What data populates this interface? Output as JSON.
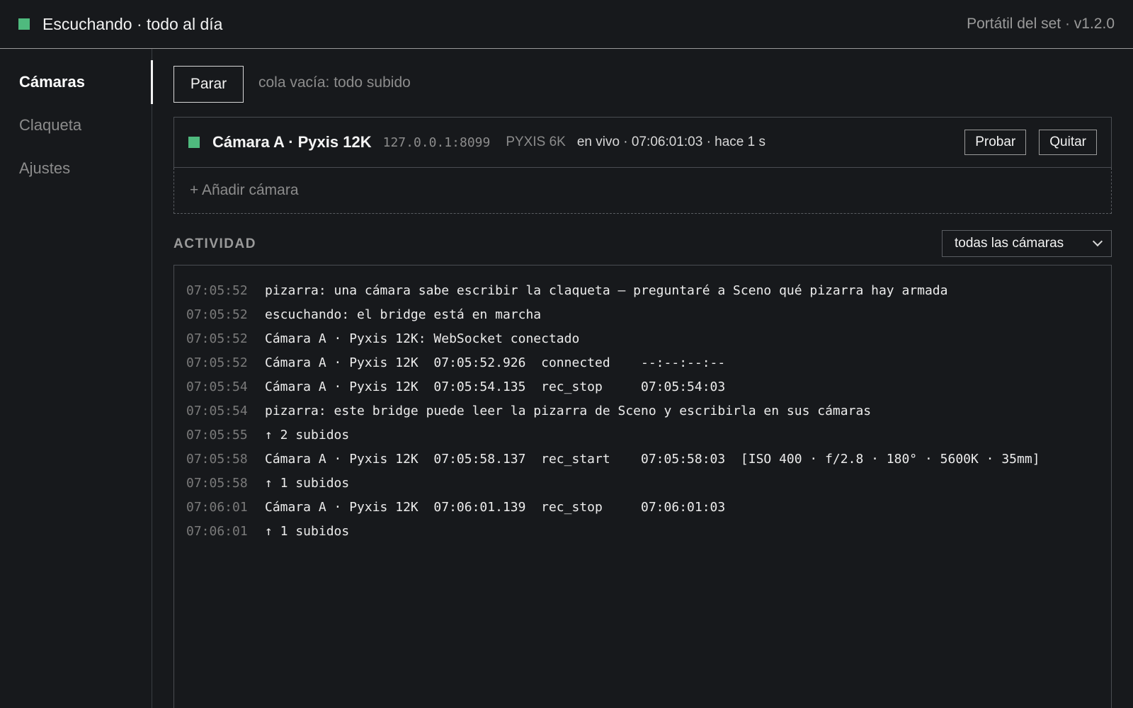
{
  "header": {
    "title": "Escuchando · todo al día",
    "version": "Portátil del set · v1.2.0",
    "status_color": "#4fba7e"
  },
  "sidebar": {
    "items": [
      {
        "label": "Cámaras",
        "active": true
      },
      {
        "label": "Claqueta",
        "active": false
      },
      {
        "label": "Ajustes",
        "active": false
      }
    ]
  },
  "main": {
    "stop_label": "Parar",
    "queue_status": "cola vacía: todo subido",
    "camera": {
      "name": "Cámara A · Pyxis 12K",
      "address": "127.0.0.1:8099",
      "model": "PYXIS 6K",
      "live_status": "en vivo · 07:06:01:03 · hace 1 s",
      "test_label": "Probar",
      "remove_label": "Quitar"
    },
    "add_camera_label": "+ Añadir cámara",
    "activity": {
      "title": "ACTIVIDAD",
      "filter_value": "todas las cámaras",
      "log": [
        {
          "time": "07:05:52",
          "msg": "pizarra: una cámara sabe escribir la claqueta — preguntaré a Sceno qué pizarra hay armada"
        },
        {
          "time": "07:05:52",
          "msg": "escuchando: el bridge está en marcha"
        },
        {
          "time": "07:05:52",
          "msg": "Cámara A · Pyxis 12K: WebSocket conectado"
        },
        {
          "time": "07:05:52",
          "msg": "Cámara A · Pyxis 12K  07:05:52.926  connected    --:--:--:--"
        },
        {
          "time": "07:05:54",
          "msg": "Cámara A · Pyxis 12K  07:05:54.135  rec_stop     07:05:54:03"
        },
        {
          "time": "07:05:54",
          "msg": "pizarra: este bridge puede leer la pizarra de Sceno y escribirla en sus cámaras"
        },
        {
          "time": "07:05:55",
          "msg": "↑ 2 subidos"
        },
        {
          "time": "07:05:58",
          "msg": "Cámara A · Pyxis 12K  07:05:58.137  rec_start    07:05:58:03  [ISO 400 · f/2.8 · 180° · 5600K · 35mm]"
        },
        {
          "time": "07:05:58",
          "msg": "↑ 1 subidos"
        },
        {
          "time": "07:06:01",
          "msg": "Cámara A · Pyxis 12K  07:06:01.139  rec_stop     07:06:01:03"
        },
        {
          "time": "07:06:01",
          "msg": "↑ 1 subidos"
        }
      ]
    }
  }
}
